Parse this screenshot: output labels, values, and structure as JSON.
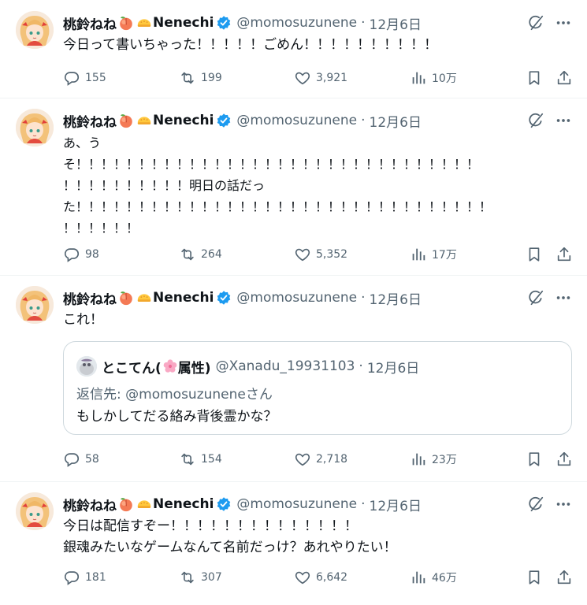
{
  "author": {
    "name": "桃鈴ねね",
    "name_suffix": "Nenechi",
    "handle": "@momosuzunene",
    "separator": "·",
    "date": "12月6日"
  },
  "icons": {
    "emoji1": "peach-icon",
    "emoji2": "sunny-bun-icon",
    "verified": "verified-badge-icon",
    "grok": "grok-icon",
    "more": "more-icon",
    "reply": "reply-icon",
    "retweet": "retweet-icon",
    "like": "like-icon",
    "views": "views-icon",
    "bookmark": "bookmark-icon",
    "share": "share-icon"
  },
  "colors": {
    "text": "#0f1419",
    "muted": "#536471",
    "verified": "#1d9bf0",
    "border": "#eff3f4"
  },
  "tweets": [
    {
      "text": "今日って書いちゃった！！！！！ごめん！！！！！！！！！！",
      "stats": {
        "replies": "155",
        "retweets": "199",
        "likes": "3,921",
        "views": "10万"
      }
    },
    {
      "text": "あ、う\nそ！！！！！！！！！！！！！！！！！！！！！！！！！！！！！！！！\n！！！！！！！！！！明日の話だっ\nた！！！！！！！！！！！！！！！！！！！！！！！！！！！！！！！！！\n！！！！！！",
      "stats": {
        "replies": "98",
        "retweets": "264",
        "likes": "5,352",
        "views": "17万"
      }
    },
    {
      "text": "これ！",
      "quote": {
        "name": "とこてん(",
        "name_tail": "属性)",
        "handle": "@Xanadu_19931103",
        "separator": "·",
        "date": "12月6日",
        "reply_label": "返信先: ",
        "reply_handle": "@momosuzunene",
        "reply_suffix": "さん",
        "text": "もしかしてだる絡み背後霊かな？",
        "emoji": "cherry-blossom-icon"
      },
      "stats": {
        "replies": "58",
        "retweets": "154",
        "likes": "2,718",
        "views": "23万"
      }
    },
    {
      "text": "今日は配信すぞー！！！！！！！！！！！！！！\n銀魂みたいなゲームなんて名前だっけ？あれやりたい！",
      "stats": {
        "replies": "181",
        "retweets": "307",
        "likes": "6,642",
        "views": "46万"
      }
    }
  ]
}
